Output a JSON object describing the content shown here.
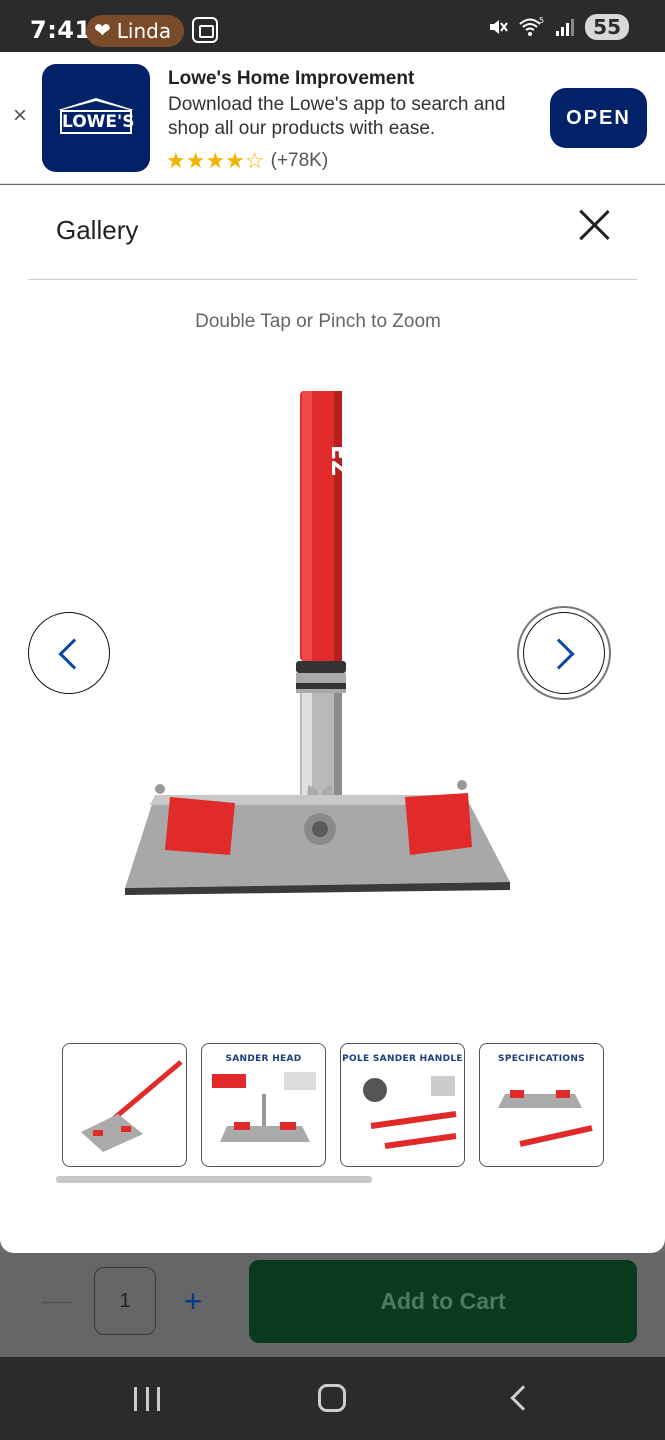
{
  "status_bar": {
    "time": "7:41",
    "contact_name": "Linda",
    "battery": "55",
    "wifi_label": "5"
  },
  "app_banner": {
    "logo_text": "LOWE'S",
    "title": "Lowe's Home Improvement",
    "description": "Download the Lowe's app to search and shop all our products with ease.",
    "rating_stars": "★★★★☆",
    "rating_value": 4.5,
    "rating_count": "(+78K)",
    "open_label": "OPEN",
    "close_icon": "×"
  },
  "gallery": {
    "title": "Gallery",
    "zoom_hint": "Double Tap or Pinch to Zoom",
    "thumbnails": [
      {
        "caption": ""
      },
      {
        "caption": "SANDER HEAD"
      },
      {
        "caption": "POLE SANDER HANDLE"
      },
      {
        "caption": "SPECIFICATIONS"
      }
    ],
    "colors": {
      "accent": "#0d47a1",
      "product_red": "#e12b2b"
    }
  },
  "cart": {
    "quantity": "1",
    "minus_label": "—",
    "plus_label": "+",
    "add_to_cart_label": "Add to Cart"
  }
}
